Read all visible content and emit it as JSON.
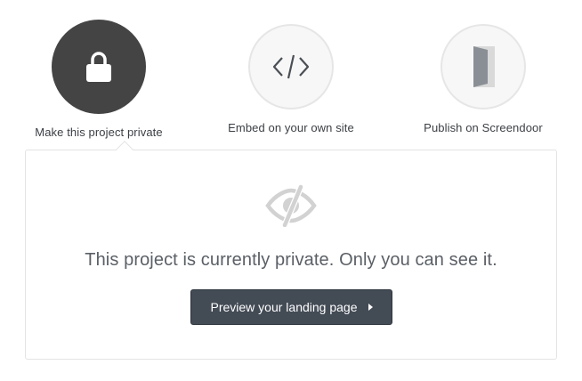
{
  "options": [
    {
      "label": "Make this project private",
      "icon": "lock-icon",
      "active": true
    },
    {
      "label": "Embed on your own site",
      "icon": "code-icon",
      "active": false
    },
    {
      "label": "Publish on Screendoor",
      "icon": "door-icon",
      "active": false
    }
  ],
  "panel": {
    "icon": "eye-hidden-icon",
    "message": "This project is currently private. Only you can see it.",
    "button_label": "Preview your landing page",
    "button_icon": "play-icon"
  },
  "colors": {
    "active_circle": "#444444",
    "button_bg": "#434b55",
    "text": "#3b3f44",
    "muted_icon": "#cfcfcf"
  }
}
